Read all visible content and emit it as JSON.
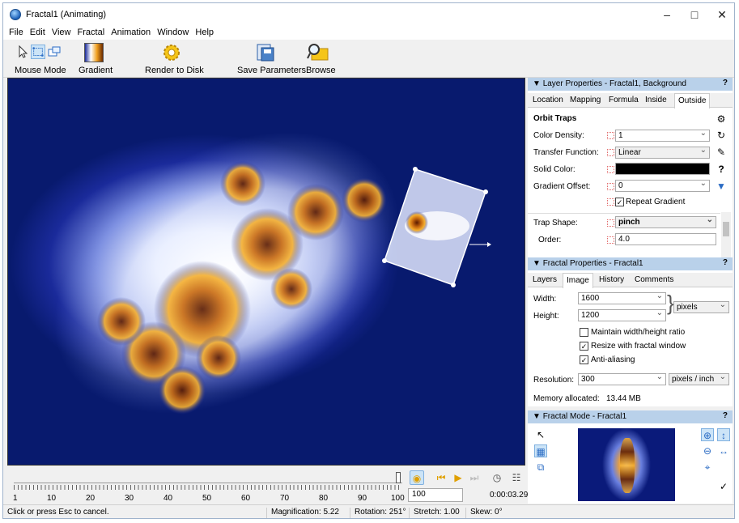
{
  "window": {
    "title": "Fractal1 (Animating)"
  },
  "menu": [
    "File",
    "Edit",
    "View",
    "Fractal",
    "Animation",
    "Window",
    "Help"
  ],
  "toolbar": {
    "mouse_mode": "Mouse Mode",
    "gradient": "Gradient",
    "render": "Render to Disk",
    "save_params": "Save Parameters",
    "browse": "Browse"
  },
  "timeline": {
    "ticks": [
      "1",
      "10",
      "20",
      "30",
      "40",
      "50",
      "60",
      "70",
      "80",
      "90",
      "100"
    ],
    "frame_value": "100",
    "time": "0:00:03.29"
  },
  "status": {
    "hint": "Click or press Esc to cancel.",
    "magnification": "Magnification: 5.22",
    "rotation": "Rotation: 251°",
    "stretch": "Stretch: 1.00",
    "skew": "Skew: 0°"
  },
  "layer_props": {
    "header": "Layer Properties - Fractal1, Background",
    "tabs": [
      "Location",
      "Mapping",
      "Formula",
      "Inside",
      "Outside"
    ],
    "section": "Orbit Traps",
    "color_density_label": "Color Density:",
    "color_density": "1",
    "transfer_label": "Transfer Function:",
    "transfer": "Linear",
    "solid_color_label": "Solid Color:",
    "gradient_offset_label": "Gradient Offset:",
    "gradient_offset": "0",
    "repeat_gradient": "Repeat Gradient",
    "trap_shape_label": "Trap Shape:",
    "trap_shape": "pinch",
    "order_label": "Order:",
    "order": "4.0"
  },
  "fractal_props": {
    "header": "Fractal Properties - Fractal1",
    "tabs": [
      "Layers",
      "Image",
      "History",
      "Comments"
    ],
    "width_label": "Width:",
    "width": "1600",
    "height_label": "Height:",
    "height": "1200",
    "unit": "pixels",
    "maintain": "Maintain width/height ratio",
    "resize": "Resize with fractal window",
    "antialias": "Anti-aliasing",
    "resolution_label": "Resolution:",
    "resolution": "300",
    "res_unit": "pixels / inch",
    "memory": "Memory allocated:",
    "memory_value": "13.44 MB"
  },
  "fractal_mode": {
    "header": "Fractal Mode - Fractal1"
  }
}
